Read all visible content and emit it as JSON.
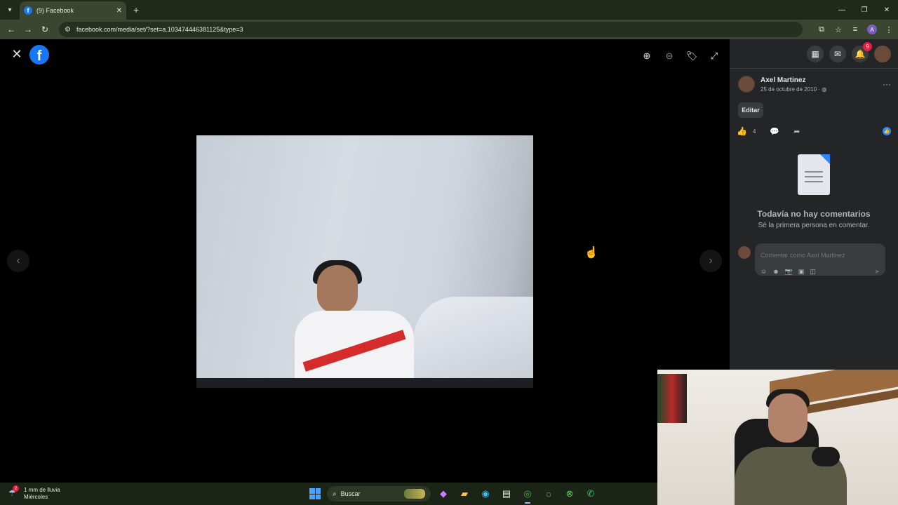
{
  "browser": {
    "tab_title": "(9) Facebook",
    "url": "facebook.com/media/set/?set=a.103474446381125&type=3",
    "profile_initial": "A"
  },
  "viewer": {
    "icons": [
      "close-icon",
      "facebook-logo",
      "zoom-in-icon",
      "zoom-out-icon",
      "tag-icon",
      "fullscreen-icon",
      "previous-icon",
      "next-icon"
    ]
  },
  "panel": {
    "notification_count": "9",
    "author_name": "Axel Martinez",
    "post_date": "25 de octubre de 2010",
    "edit_label": "Editar",
    "like_count": "4",
    "empty_title": "Todavía no hay comentarios",
    "empty_subtitle": "Sé la primera persona en comentar.",
    "comment_placeholder": "Comentar como Axel Martinez"
  },
  "taskbar": {
    "weather_badge": "2",
    "weather_line1": "1 mm de lluvia",
    "weather_line2": "Miércoles",
    "search_label": "Buscar"
  },
  "colors": {
    "facebook_blue": "#1877f2",
    "panel_bg": "#242526",
    "notification_red": "#e41e3f"
  }
}
